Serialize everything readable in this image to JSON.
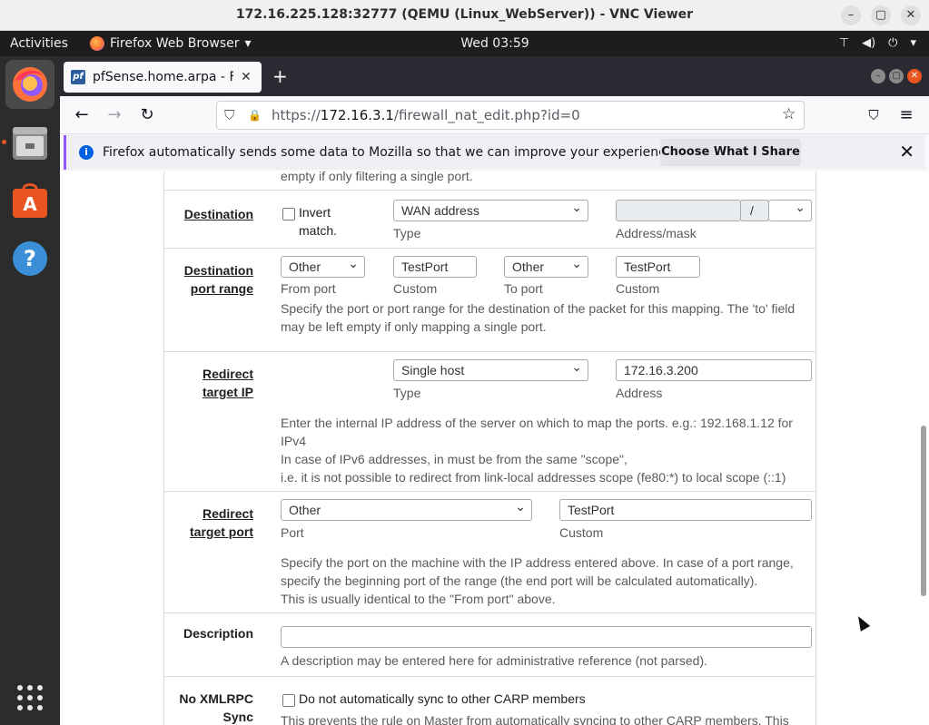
{
  "vnc": {
    "title": "172.16.225.128:32777 (QEMU (Linux_WebServer)) - VNC Viewer",
    "min": "–",
    "max": "▢",
    "close": "✕"
  },
  "gnome": {
    "activities": "Activities",
    "app_menu": "Firefox Web Browser",
    "app_menu_caret": "▾",
    "clock": "Wed 03:59",
    "tray": {
      "network": "⊤",
      "volume": "◀)",
      "power": "⏻",
      "caret": "▾"
    }
  },
  "dock": {
    "items": [
      "firefox-icon",
      "files-icon",
      "software-center-icon",
      "help-icon",
      "app-grid-icon"
    ],
    "help_glyph": "?",
    "grid_glyph": "⁝⁝⁝"
  },
  "browser": {
    "tab_title": "pfSense.home.arpa - Firewall",
    "tab_favicon": "pf",
    "tab_close": "✕",
    "new_tab": "+",
    "back": "←",
    "forward": "→",
    "reload": "↻",
    "url_scheme": "https://",
    "url_host": "172.16.3.1",
    "url_path": "/firewall_nat_edit.php?id=0",
    "shield": "⛉",
    "lock": "🔒",
    "bookmark_star": "☆",
    "pocket": "⛉",
    "menu": "≡",
    "window_buttons": {
      "min": "–",
      "max": "▢",
      "close": "✕"
    }
  },
  "notification": {
    "info": "i",
    "message": "Firefox automatically sends some data to Mozilla so that we can improve your experience.",
    "button": "Choose What I Share",
    "close": "✕"
  },
  "form": {
    "top_help_tail": "empty if only filtering a single port.",
    "destination": {
      "label": "Destination",
      "invert_label_1": "Invert",
      "invert_label_2": "match.",
      "type_value": "WAN address",
      "type_caption": "Type",
      "mask_sep": "/",
      "address_caption": "Address/mask"
    },
    "dest_port_range": {
      "label_1": "Destination",
      "label_2": "port range",
      "from_port_value": "Other",
      "from_port_caption": "From port",
      "from_custom_value": "TestPort",
      "from_custom_caption": "Custom",
      "to_port_value": "Other",
      "to_port_caption": "To port",
      "to_custom_value": "TestPort",
      "to_custom_caption": "Custom",
      "help_1": "Specify the port or port range for the destination of the packet for this mapping. The 'to' field",
      "help_2": "may be left empty if only mapping a single port."
    },
    "redirect_ip": {
      "label_1": "Redirect",
      "label_2": "target IP",
      "type_value": "Single host",
      "type_caption": "Type",
      "address_value": "172.16.3.200",
      "address_caption": "Address",
      "help_1": "Enter the internal IP address of the server on which to map the ports. e.g.: 192.168.1.12 for",
      "help_2": "IPv4",
      "help_3": "In case of IPv6 addresses, in must be from the same \"scope\",",
      "help_4": "i.e. it is not possible to redirect from link-local addresses scope (fe80:*) to local scope (::1)"
    },
    "redirect_port": {
      "label_1": "Redirect",
      "label_2": "target port",
      "port_value": "Other",
      "port_caption": "Port",
      "custom_value": "TestPort",
      "custom_caption": "Custom",
      "help_1": "Specify the port on the machine with the IP address entered above. In case of a port range,",
      "help_2": "specify the beginning port of the range (the end port will be calculated automatically).",
      "help_3": "This is usually identical to the \"From port\" above."
    },
    "description": {
      "label": "Description",
      "value": "",
      "help": "A description may be entered here for administrative reference (not parsed)."
    },
    "xmlrpc": {
      "label_1": "No XMLRPC",
      "label_2": "Sync",
      "checkbox_label": "Do not automatically sync to other CARP members",
      "help_1": "This prevents the rule on Master from automatically syncing to other CARP members. This"
    }
  }
}
